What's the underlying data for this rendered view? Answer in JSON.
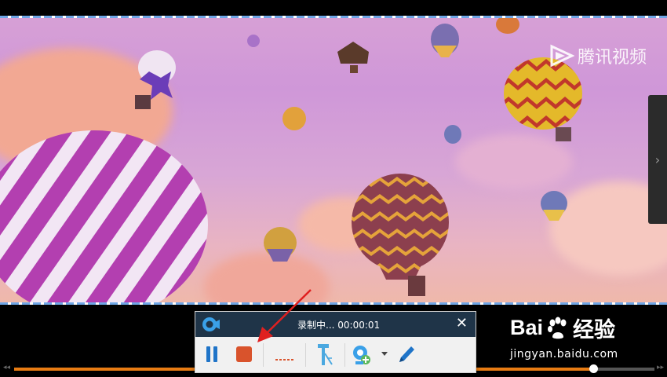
{
  "watermark": {
    "text": "腾讯视频"
  },
  "side_panel": {
    "arrow": "›"
  },
  "recorder": {
    "status_text": "录制中... 00:00:01",
    "close_glyph": "✕"
  },
  "playback": {
    "progress": 0.905
  },
  "baidu": {
    "logo_left": "Bai",
    "logo_right": "经验",
    "domain": "jingyan.baidu.com"
  },
  "colors": {
    "accent_orange": "#e87c13",
    "stop_red": "#d9532c",
    "pause_blue": "#1f74c8",
    "header_navy": "#1f3448"
  }
}
